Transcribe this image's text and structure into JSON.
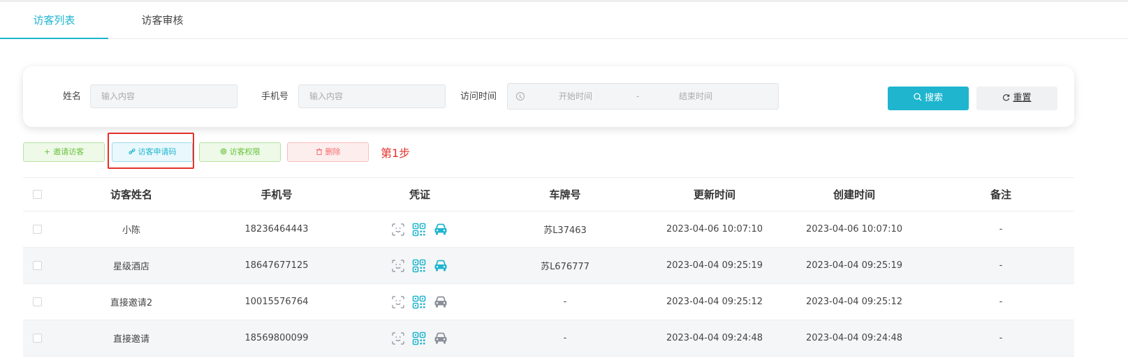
{
  "tabs": [
    {
      "label": "访客列表",
      "active": true
    },
    {
      "label": "访客审核",
      "active": false
    }
  ],
  "search": {
    "name_label": "姓名",
    "name_placeholder": "输入内容",
    "phone_label": "手机号",
    "phone_placeholder": "输入内容",
    "time_label": "访问时间",
    "start_placeholder": "开始时间",
    "separator": "-",
    "end_placeholder": "结束时间",
    "search_button": "搜索",
    "reset_button": "重置"
  },
  "actions": {
    "invite": "邀请访客",
    "code": "访客申请码",
    "permission": "访客权限",
    "delete": "删除"
  },
  "annotation": "第1步",
  "table": {
    "headers": [
      "访客姓名",
      "手机号",
      "凭证",
      "车牌号",
      "更新时间",
      "创建时间",
      "备注"
    ],
    "rows": [
      {
        "name": "小陈",
        "phone": "18236464443",
        "car_active": true,
        "plate": "苏L37463",
        "updated": "2023-04-06 10:07:10",
        "created": "2023-04-06 10:07:10",
        "note": "-"
      },
      {
        "name": "星级酒店",
        "phone": "18647677125",
        "car_active": true,
        "plate": "苏L676777",
        "updated": "2023-04-04 09:25:19",
        "created": "2023-04-04 09:25:19",
        "note": "-"
      },
      {
        "name": "直接邀请2",
        "phone": "10015576764",
        "car_active": false,
        "plate": "-",
        "updated": "2023-04-04 09:25:12",
        "created": "2023-04-04 09:25:12",
        "note": "-"
      },
      {
        "name": "直接邀请",
        "phone": "18569800099",
        "car_active": false,
        "plate": "-",
        "updated": "2023-04-04 09:24:48",
        "created": "2023-04-04 09:24:48",
        "note": "-"
      }
    ]
  },
  "colors": {
    "accent": "#1fb5cf",
    "success": "#67c23a",
    "danger": "#f56c6c",
    "annotation": "#e5302a",
    "inactive_icon": "#8a8f99"
  },
  "icons": {
    "credential": [
      "face-id-icon",
      "qr-code-icon",
      "car-icon"
    ],
    "search": "search-icon",
    "reset": "refresh-icon"
  }
}
